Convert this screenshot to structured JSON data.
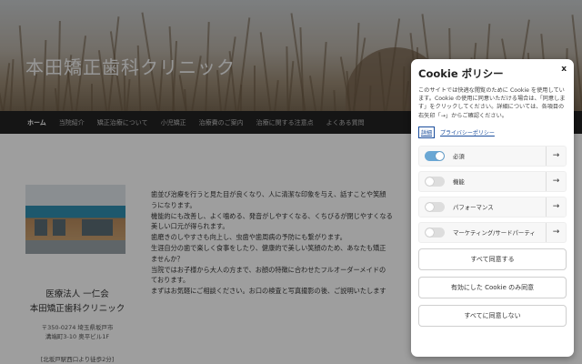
{
  "site": {
    "title": "本田矯正歯科クリニック"
  },
  "nav": [
    "ホーム",
    "当院紹介",
    "矯正治療について",
    "小児矯正",
    "治療費のご案内",
    "治療に関する注意点",
    "よくある質問"
  ],
  "clinic": {
    "name1": "医療法人 一仁会",
    "name2": "本田矯正歯科クリニック",
    "address1": "〒350-0274 埼玉県坂戸市",
    "address2": "溝端町3-10 奥平ビル1F",
    "access": "[北坂戸駅西口より徒歩2分]"
  },
  "body_lines": [
    "歯並び治療を行うと見た目が良くなり、人に清潔な印象を与え、話すことや笑顔",
    "うになります。",
    "機能的にも改善し、よく噛める、発音がしやすくなる、くちびるが閉じやすくなる",
    "美しい口元が得られます。",
    "歯磨きのしやすさも向上し、虫歯や歯周病の予防にも繋がります。",
    "生涯自分の歯で楽しく食事をしたり、健康的で美しい笑顔のため、あなたも矯正",
    "ませんか？",
    "当院ではお子様から大人の方まで、お顔の特徴に合わせたフルオーダーメイドの",
    "ております。",
    "まずはお気軽にご相談ください。お口の検査と写真撮影の後、ご説明いたします"
  ],
  "cookie": {
    "title": "Cookie ポリシー",
    "close": "x",
    "description": "このサイトでは快適な閲覧のために Cookie を使用しています。Cookie の使用に同意いただける場合は、「同意します」をクリックしてください。詳細については、各項目の右矢印「→」からご確認ください。",
    "link_detail": "詳細",
    "link_privacy": "プライバシーポリシー",
    "categories": [
      {
        "label": "必須",
        "enabled": true
      },
      {
        "label": "機能",
        "enabled": false
      },
      {
        "label": "パフォーマンス",
        "enabled": false
      },
      {
        "label": "マーケティング/サードパーティ",
        "enabled": false
      }
    ],
    "arrow": "→",
    "accept_all": "すべて同意する",
    "accept_selected": "有効にした Cookie のみ同意",
    "reject_all": "すべてに同意しない"
  },
  "colors": {
    "toggle_on": "#6aa7d4",
    "nav_bg": "#222222",
    "link": "#1a4d9c"
  }
}
